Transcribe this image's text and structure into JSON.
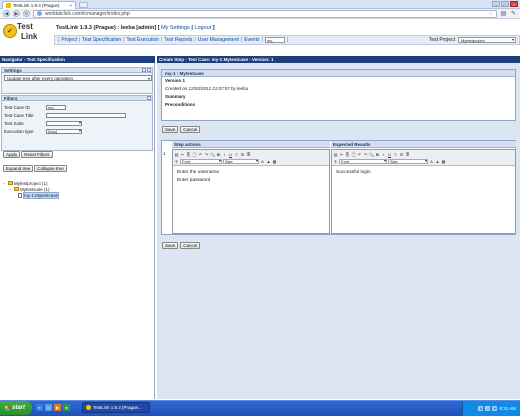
{
  "browser": {
    "tab_title": "TestLink 1.9.3 (Prague)",
    "url": "worldatclick.com/tcmanager/index.php",
    "tab_close": "×",
    "win_minimize": "–",
    "win_maximize": "□",
    "win_close": "×"
  },
  "header": {
    "logo_line1": "Test",
    "logo_line2": "Link",
    "version": "TestLink 1.9.3 (Prague) : leeba [admin]",
    "my_settings": "My Settings",
    "logout": "Logout",
    "menu": {
      "project": "Project",
      "test_specification": "Test Specification",
      "test_execution": "Test Execution",
      "test_reports": "Test Reports",
      "user_management": "User Management",
      "events": "Events",
      "search_value": "my-",
      "test_project_label": "Test Project",
      "test_project_value": "Myfestproject"
    }
  },
  "navigator": {
    "title": "Navigator - Test Specification",
    "settings": {
      "title": "Settings",
      "select_value": "Update tree after every operation"
    },
    "filters": {
      "title": "Filters",
      "test_case_id_label": "Test Case ID",
      "test_case_id_value": "my-",
      "test_case_title_label": "Test Case Title",
      "test_case_title_value": "",
      "test_suite_label": "Test Suite",
      "test_suite_value": "",
      "execution_type_label": "Execution type",
      "execution_type_value": "[Any]",
      "apply_button": "Apply",
      "reset_button": "Reset Filters"
    },
    "expand_button": "Expand tree",
    "collapse_button": "Collapse tree",
    "tree": [
      {
        "label": "Myfestproject (1)",
        "level": 0,
        "type": "project"
      },
      {
        "label": "Mytestsuite (1)",
        "level": 1,
        "type": "suite"
      },
      {
        "label": "my-1:Mytestcase",
        "level": 2,
        "type": "testcase"
      }
    ]
  },
  "main": {
    "title": "Create Step - Test Case: my-1:Mytestcase - Version: 1",
    "testcase": {
      "header": "my-1 : Mytestcase",
      "version": "Version 1",
      "created": "Created on 12/03/2012 21:07:07  by leeba",
      "summary": "Summary",
      "preconditions": "Preconditions"
    },
    "save_button": "Save",
    "cancel_button": "Cancel",
    "step_number": "1",
    "step_actions_header": "Step actions",
    "expected_results_header": "Expected Results",
    "editor_font_label": "Font",
    "editor_size_label": "Size",
    "step_actions_lines": [
      "Enter the username",
      "Enter password"
    ],
    "expected_results_lines": [
      "Successful login"
    ]
  },
  "taskbar": {
    "start": "start",
    "task_label": "TestLink 1.9.3 (Prague...",
    "clock": "9:31 AM"
  }
}
